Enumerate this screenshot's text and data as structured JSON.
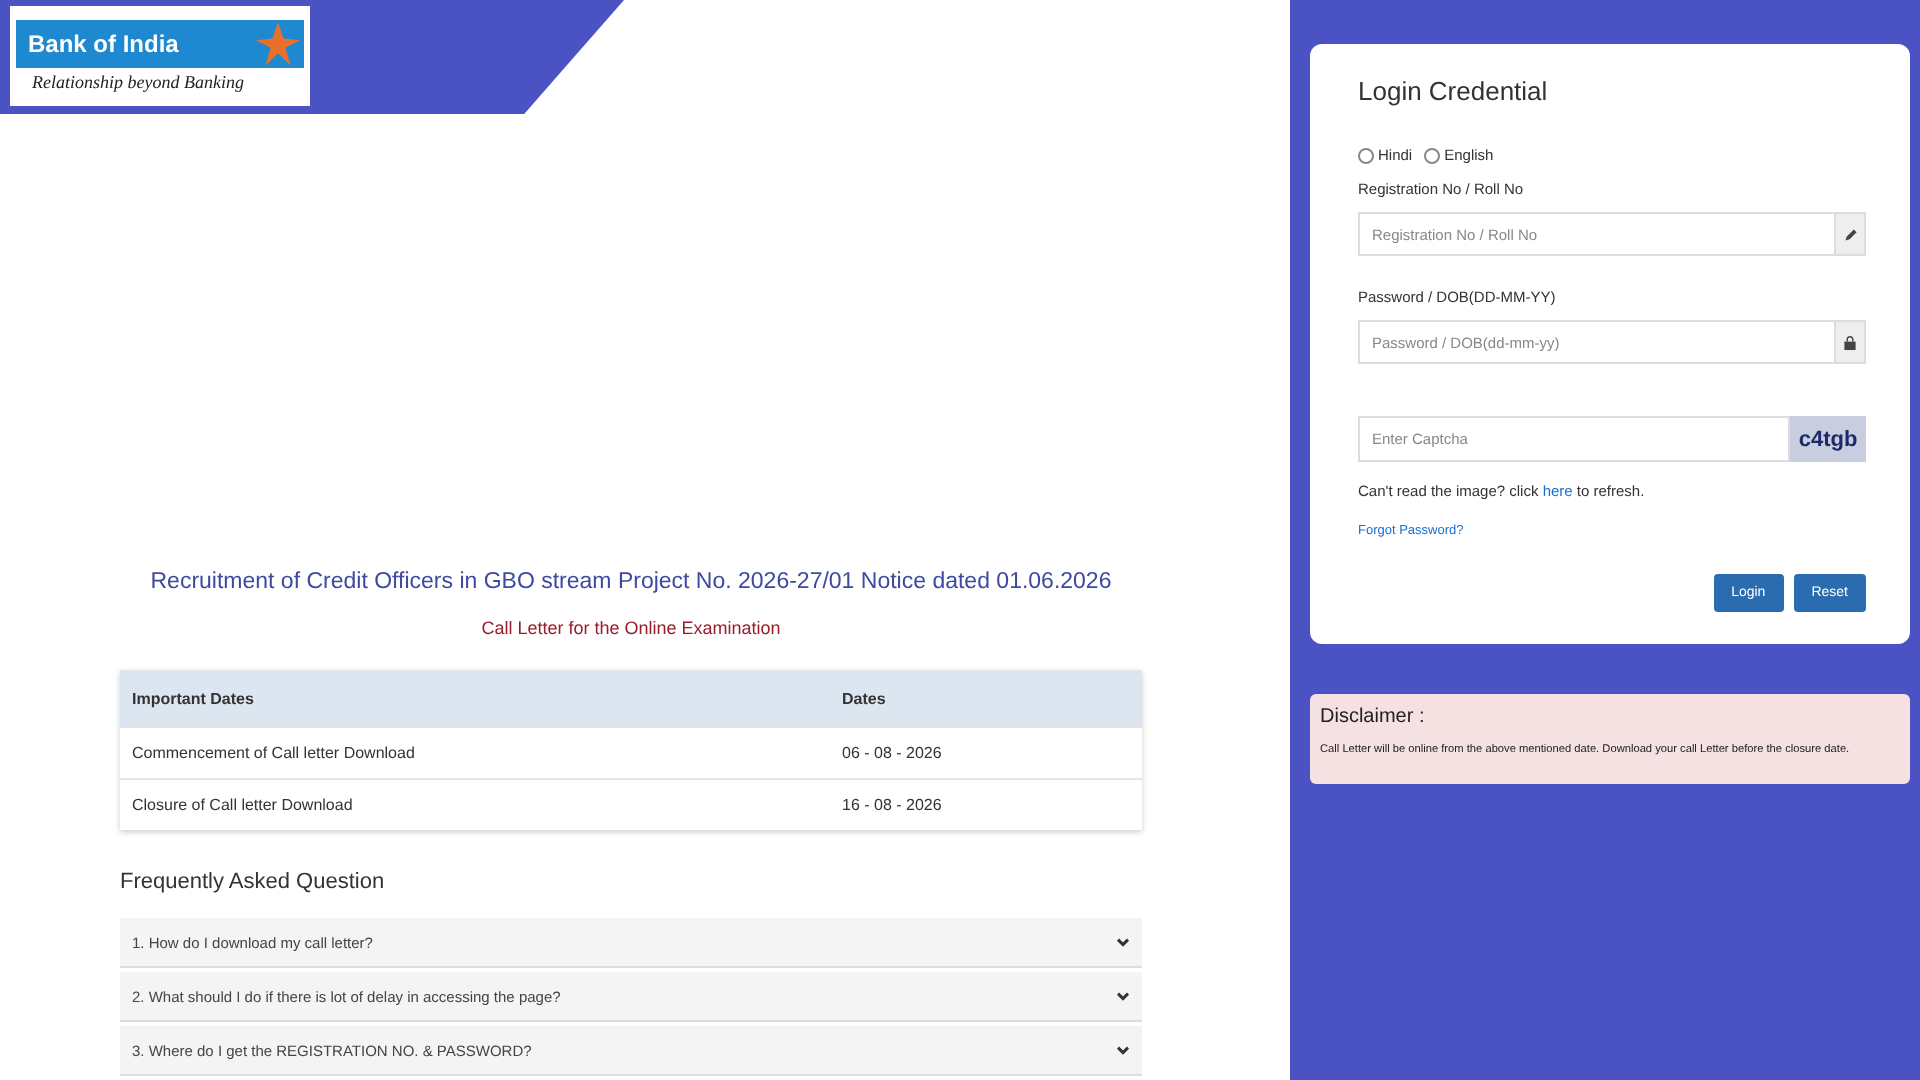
{
  "logo": {
    "name": "Bank of India",
    "tagline": "Relationship beyond Banking"
  },
  "notice": {
    "title": "Recruitment of Credit Officers in GBO stream Project No. 2026-27/01 Notice dated 01.06.2026",
    "subtitle": "Call Letter for the Online Examination"
  },
  "dates_table": {
    "columns": [
      "Important Dates",
      "Dates"
    ],
    "rows": [
      {
        "event": "Commencement of Call letter Download",
        "date": "06 - 08 - 2026"
      },
      {
        "event": "Closure of Call letter Download",
        "date": "16 - 08 - 2026"
      }
    ]
  },
  "faq": {
    "title": "Frequently Asked Question",
    "items": [
      {
        "question": "1. How do I download my call letter?",
        "expanded": false
      },
      {
        "question": "2. What should I do if there is lot of delay in accessing the page?",
        "expanded": false
      },
      {
        "question": "3. Where do I get the REGISTRATION NO. & PASSWORD?",
        "expanded": false
      }
    ]
  },
  "login": {
    "title": "Login Credential",
    "languages": [
      {
        "label": "Hindi",
        "selected": false
      },
      {
        "label": "English",
        "selected": false
      }
    ],
    "registration": {
      "label": "Registration No / Roll No",
      "placeholder": "Registration No / Roll No"
    },
    "password": {
      "label": "Password / DOB(DD-MM-YY)",
      "placeholder": "Password / DOB(dd-mm-yy)"
    },
    "captcha": {
      "placeholder": "Enter Captcha",
      "image_text": "c4tgb"
    },
    "refresh_text": "Can't read the image? click ",
    "refresh_link": "here",
    "refresh_tail": " to refresh.",
    "forgot": "Forgot Password?",
    "buttons": [
      "Login",
      "Reset"
    ]
  },
  "disclaimer": {
    "title": "Disclaimer :",
    "text": "Call Letter will be online from the above mentioned date. Download your call Letter before the closure date."
  }
}
